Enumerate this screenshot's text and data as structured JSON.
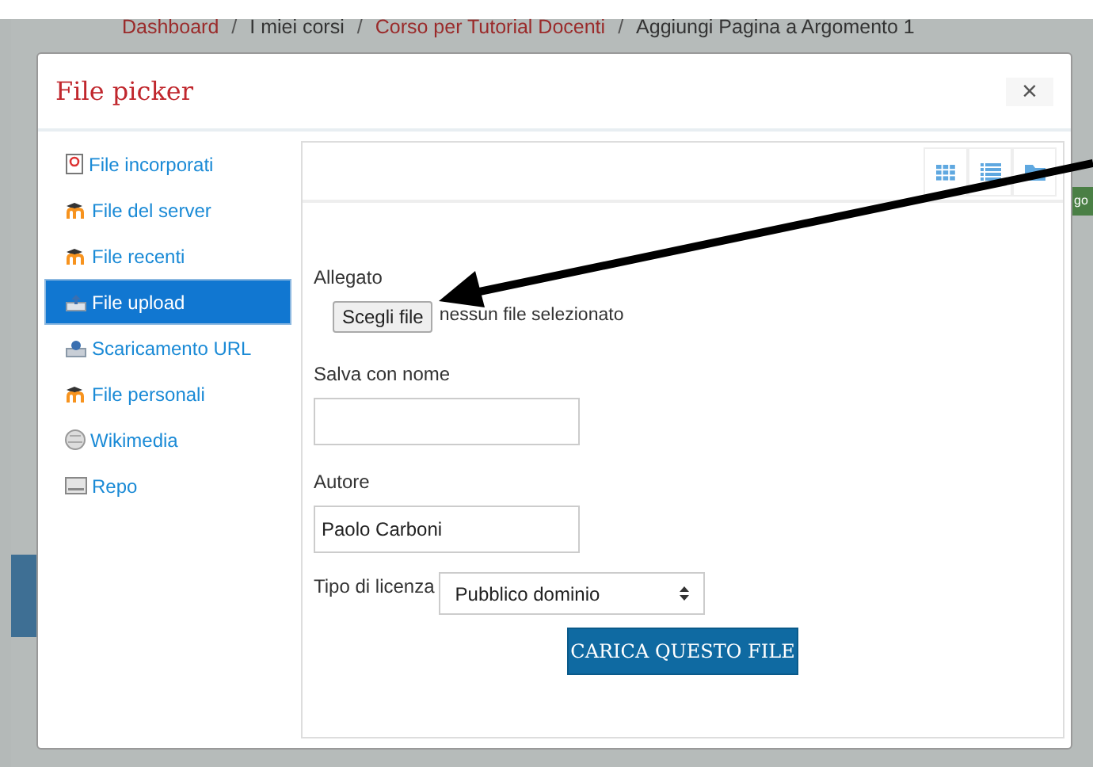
{
  "breadcrumb": [
    {
      "label": "Dashboard",
      "kind": "link"
    },
    {
      "label": "/",
      "kind": "separator"
    },
    {
      "label": "I miei corsi",
      "kind": "text"
    },
    {
      "label": "/",
      "kind": "separator"
    },
    {
      "label": "Corso per Tutorial Docenti",
      "kind": "link"
    },
    {
      "label": "/",
      "kind": "separator"
    },
    {
      "label": "Aggiungi Pagina a Argomento 1",
      "kind": "text"
    }
  ],
  "background_button": {
    "label": "go"
  },
  "dialog": {
    "title": "File picker",
    "close": "×"
  },
  "sidebar": {
    "items": [
      {
        "label": "File incorporati",
        "kind": "document",
        "selected": false
      },
      {
        "label": "File del server",
        "kind": "moodle",
        "selected": false
      },
      {
        "label": "File recenti",
        "kind": "moodle",
        "selected": false
      },
      {
        "label": "File upload",
        "kind": "upload",
        "selected": true
      },
      {
        "label": "Scaricamento URL",
        "kind": "download",
        "selected": false
      },
      {
        "label": "File personali",
        "kind": "moodle",
        "selected": false
      },
      {
        "label": "Wikimedia",
        "kind": "globe",
        "selected": false
      },
      {
        "label": "Repo",
        "kind": "drive",
        "selected": false
      }
    ]
  },
  "view_buttons": [
    {
      "kind": "grid"
    },
    {
      "kind": "list"
    },
    {
      "kind": "folder"
    }
  ],
  "form": {
    "attachment_label": "Allegato",
    "choose_button": "Scegli file",
    "no_file": "nessun file selezionato",
    "save_as_label": "Salva con nome",
    "author_label": "Autore",
    "author_value": "Paolo Carboni",
    "license_label": "Tipo di licenza",
    "license_value": "Pubblico dominio",
    "submit": "CARICA QUESTO FILE"
  }
}
